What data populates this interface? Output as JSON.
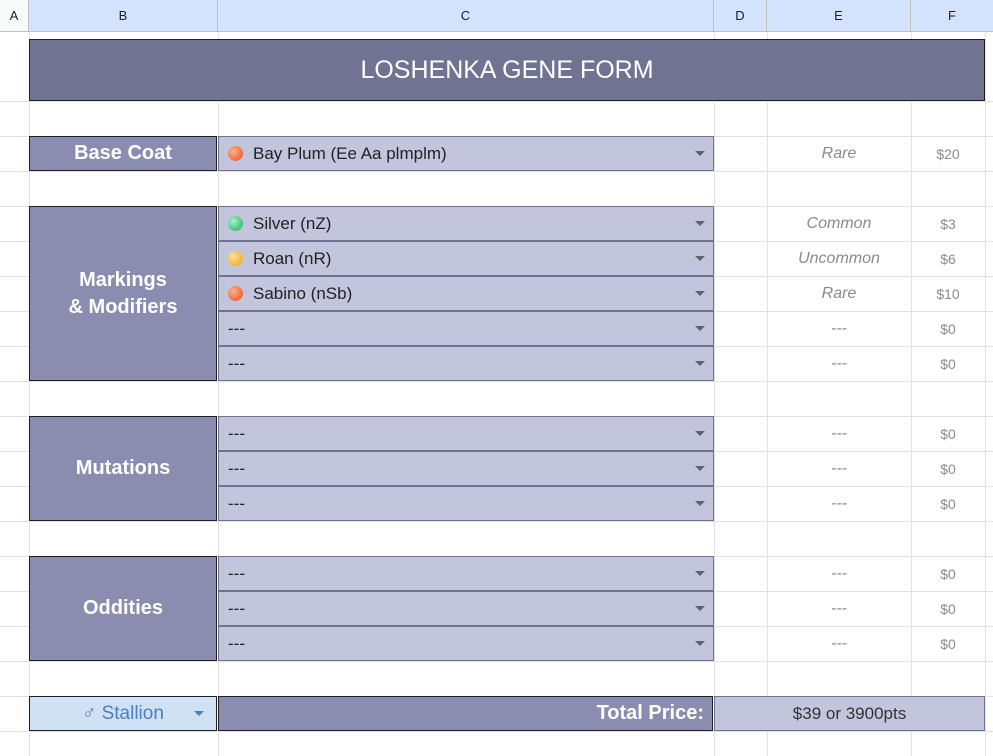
{
  "columns": [
    "A",
    "B",
    "C",
    "D",
    "E",
    "F"
  ],
  "title": "LOSHENKA GENE FORM",
  "base_coat": {
    "label": "Base Coat",
    "row": {
      "value": "Bay Plum (Ee Aa plmplm)",
      "dot": "#f06a3a",
      "rarity": "Rare",
      "price": "$20"
    }
  },
  "markings": {
    "label_line1": "Markings",
    "label_line2": "& Modifiers",
    "rows": [
      {
        "value": "Silver (nZ)",
        "dot": "#3ec47a",
        "rarity": "Common",
        "price": "$3"
      },
      {
        "value": "Roan (nR)",
        "dot": "#f2b42e",
        "rarity": "Uncommon",
        "price": "$6"
      },
      {
        "value": "Sabino (nSb)",
        "dot": "#f06a3a",
        "rarity": "Rare",
        "price": "$10"
      },
      {
        "value": "---",
        "rarity": "---",
        "price": "$0"
      },
      {
        "value": "---",
        "rarity": "---",
        "price": "$0"
      }
    ]
  },
  "mutations": {
    "label": "Mutations",
    "rows": [
      {
        "value": "---",
        "rarity": "---",
        "price": "$0"
      },
      {
        "value": "---",
        "rarity": "---",
        "price": "$0"
      },
      {
        "value": "---",
        "rarity": "---",
        "price": "$0"
      }
    ]
  },
  "oddities": {
    "label": "Oddities",
    "rows": [
      {
        "value": "---",
        "rarity": "---",
        "price": "$0"
      },
      {
        "value": "---",
        "rarity": "---",
        "price": "$0"
      },
      {
        "value": "---",
        "rarity": "---",
        "price": "$0"
      }
    ]
  },
  "sex": {
    "value": "♂ Stallion"
  },
  "total": {
    "label": "Total Price:",
    "value": "$39 or 3900pts"
  },
  "colors": {
    "title_bg": "#707391",
    "label_bg": "#8b8db0",
    "dropdown_bg": "#c2c5dc",
    "header_bg": "#d3e3fd"
  }
}
